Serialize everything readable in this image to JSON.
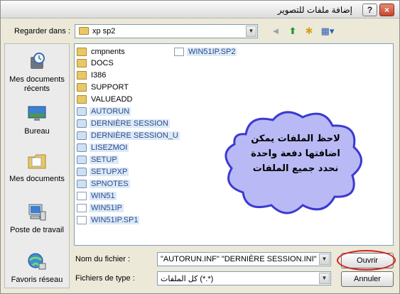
{
  "window": {
    "title": "إضافة ملفات للتصوير",
    "help_label": "?",
    "close_label": "×"
  },
  "toolbar": {
    "lookin_label": "Regarder dans :",
    "lookin_value": "xp sp2",
    "dropdown_glyph": "▼",
    "back_glyph": "◄",
    "up_glyph": "⬆",
    "newfolder_glyph": "✱",
    "views_glyph": "▦▾"
  },
  "places": [
    {
      "label": "Mes documents récents",
      "icon": "recent-documents-icon"
    },
    {
      "label": "Bureau",
      "icon": "desktop-icon"
    },
    {
      "label": "Mes documents",
      "icon": "my-documents-icon"
    },
    {
      "label": "Poste de travail",
      "icon": "my-computer-icon"
    },
    {
      "label": "Favoris réseau",
      "icon": "network-places-icon"
    }
  ],
  "files": [
    {
      "name": "cmpnents",
      "type": "folder",
      "selected": false
    },
    {
      "name": "DOCS",
      "type": "folder",
      "selected": false
    },
    {
      "name": "I386",
      "type": "folder",
      "selected": false
    },
    {
      "name": "SUPPORT",
      "type": "folder",
      "selected": false
    },
    {
      "name": "VALUEADD",
      "type": "folder",
      "selected": false
    },
    {
      "name": "AUTORUN",
      "type": "app",
      "selected": true
    },
    {
      "name": "DERNIÈRE SESSION",
      "type": "app",
      "selected": true
    },
    {
      "name": "DERNIÈRE SESSION_U",
      "type": "app",
      "selected": true
    },
    {
      "name": "LISEZMOI",
      "type": "app",
      "selected": true
    },
    {
      "name": "SETUP",
      "type": "app",
      "selected": true
    },
    {
      "name": "SETUPXP",
      "type": "app",
      "selected": true
    },
    {
      "name": "SPNOTES",
      "type": "app",
      "selected": true
    },
    {
      "name": "WIN51",
      "type": "doc",
      "selected": true
    },
    {
      "name": "WIN51IP",
      "type": "doc",
      "selected": true
    },
    {
      "name": "WIN51IP.SP1",
      "type": "doc",
      "selected": true
    },
    {
      "name": "WIN51IP.SP2",
      "type": "doc",
      "selected": true
    }
  ],
  "annotation": {
    "lines": [
      "لاحظ الملفات يمكن",
      "اضافتها دفعة واحدة",
      "نحدد جميع الملفات"
    ],
    "bubble_color": "#b9b9f5",
    "bubble_stroke": "#3a3ad0"
  },
  "footer": {
    "filename_label": "Nom du fichier :",
    "filename_value": "\"AUTORUN.INF\" \"DERNIÈRE SESSION.INI\"",
    "filetype_label": "Fichiers de type :",
    "filetype_value": "كل الملفات (*.*)",
    "open_label": "Ouvrir",
    "cancel_label": "Annuler"
  },
  "colors": {
    "highlight_ring": "#d02020",
    "selection": "#dce9f7"
  }
}
